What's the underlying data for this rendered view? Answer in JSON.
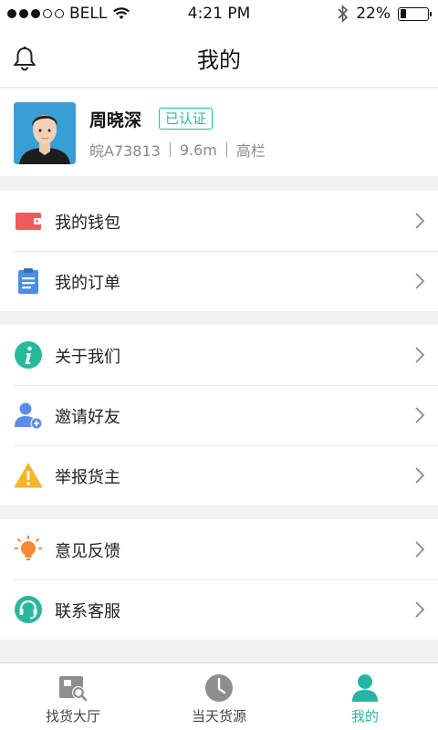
{
  "status_bar": {
    "carrier": "BELL",
    "time": "4:21 PM",
    "battery": "22%",
    "battery_level": 0.22
  },
  "header": {
    "title": "我的",
    "left_icon": "bell-icon"
  },
  "profile": {
    "name": "周晓深",
    "badge": "已认证",
    "plate": "皖A73813",
    "length": "9.6m",
    "truck_type": "高栏"
  },
  "menu": {
    "group1": [
      {
        "label": "我的钱包",
        "icon": "wallet-icon",
        "color": "#f05a5a"
      },
      {
        "label": "我的订单",
        "icon": "clipboard-icon",
        "color": "#4a8fe2"
      }
    ],
    "group2": [
      {
        "label": "关于我们",
        "icon": "info-icon",
        "color": "#2ab89c"
      },
      {
        "label": "邀请好友",
        "icon": "add-user-icon",
        "color": "#5b8fe6"
      },
      {
        "label": "举报货主",
        "icon": "warning-icon",
        "color": "#f5b62a"
      }
    ],
    "group3": [
      {
        "label": "意见反馈",
        "icon": "bulb-icon",
        "color": "#f5893a"
      },
      {
        "label": "联系客服",
        "icon": "headset-icon",
        "color": "#2ab89c"
      }
    ]
  },
  "tabbar": {
    "tabs": [
      {
        "label": "找货大厅",
        "icon": "search-goods-icon"
      },
      {
        "label": "当天货源",
        "icon": "clock-icon"
      },
      {
        "label": "我的",
        "icon": "person-icon",
        "active": true
      }
    ],
    "active_color": "#26b5a1"
  }
}
